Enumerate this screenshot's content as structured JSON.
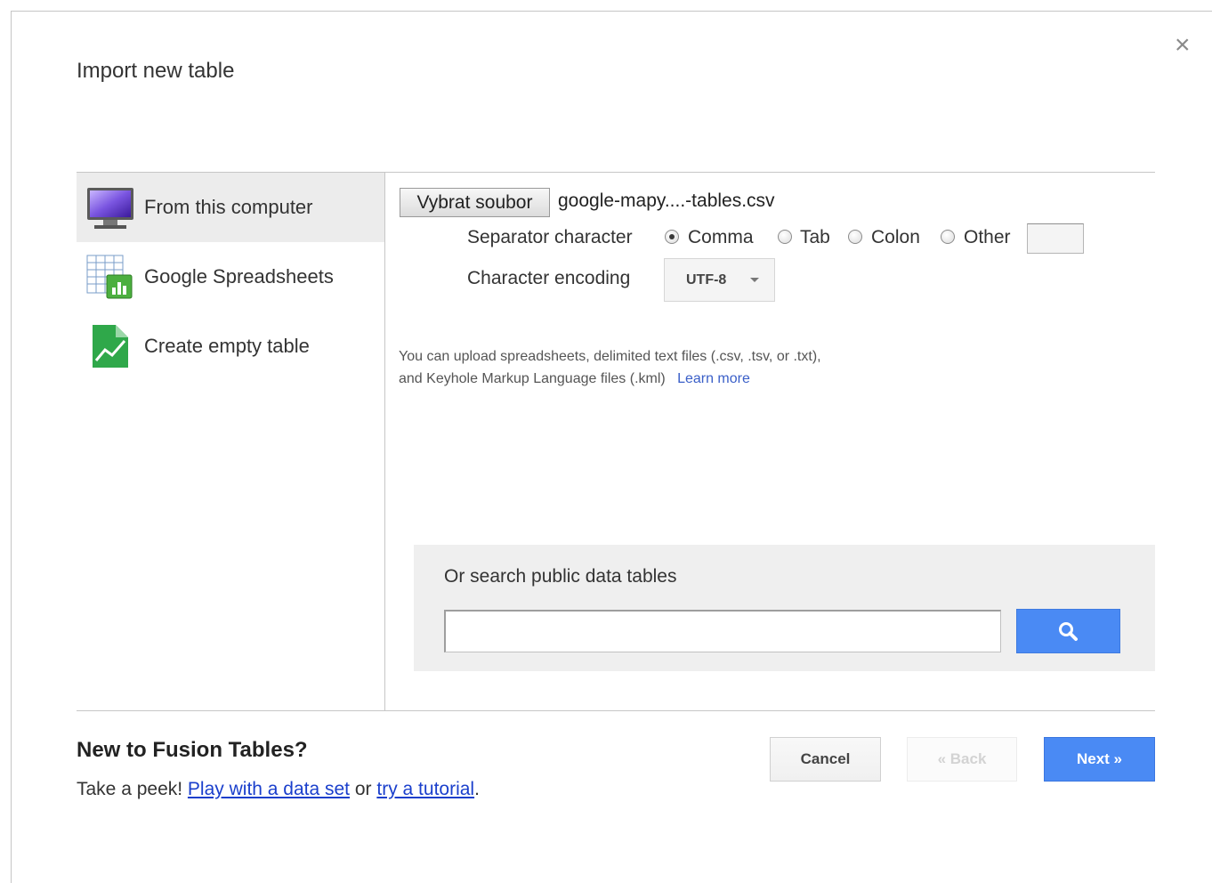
{
  "dialog": {
    "title": "Import new table",
    "close_glyph": "×"
  },
  "sources": [
    {
      "label": "From this computer",
      "icon": "monitor-icon",
      "selected": true
    },
    {
      "label": "Google Spreadsheets",
      "icon": "spreadsheet-icon",
      "selected": false
    },
    {
      "label": "Create empty table",
      "icon": "empty-table-icon",
      "selected": false
    }
  ],
  "upload": {
    "file_button_label": "Vybrat soubor",
    "file_name": "google-mapy....-tables.csv",
    "separator_label": "Separator character",
    "separator_options": [
      {
        "label": "Comma",
        "checked": true
      },
      {
        "label": "Tab",
        "checked": false
      },
      {
        "label": "Colon",
        "checked": false
      },
      {
        "label": "Other",
        "checked": false
      }
    ],
    "other_value": "",
    "encoding_label": "Character encoding",
    "encoding_value": "UTF-8",
    "help_line1": "You can upload spreadsheets, delimited text files (.csv, .tsv, or .txt),",
    "help_line2": "and Keyhole Markup Language files (.kml)",
    "learn_more": "Learn more"
  },
  "search": {
    "heading": "Or search public data tables",
    "placeholder": "",
    "button_icon": "search-icon"
  },
  "promo": {
    "title": "New to Fusion Tables?",
    "prefix": "Take a peek! ",
    "link1": "Play with a data set",
    "middle": " or ",
    "link2": "try a tutorial",
    "suffix": "."
  },
  "actions": {
    "cancel": "Cancel",
    "back": "« Back",
    "next": "Next »"
  },
  "colors": {
    "accent": "#4a8af4",
    "link": "#3a5fc8"
  }
}
